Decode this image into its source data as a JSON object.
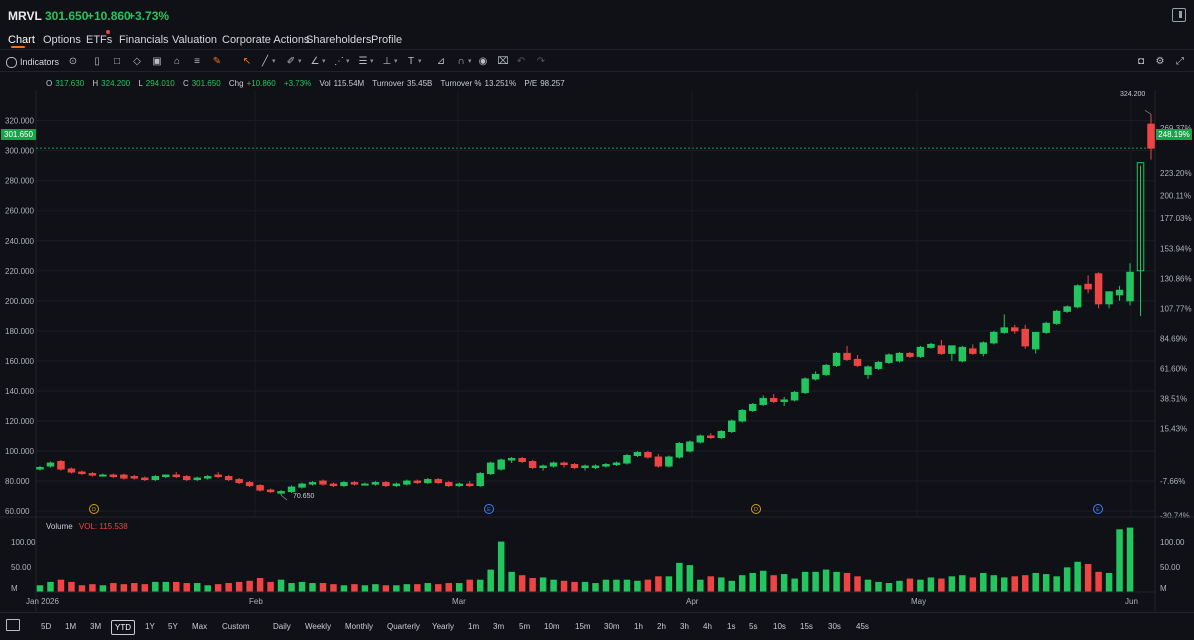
{
  "header": {
    "ticker": "MRVL",
    "price": "301.650",
    "change": "+10.860",
    "change_pct": "+3.73%"
  },
  "tabs": [
    {
      "label": "Chart",
      "active": true
    },
    {
      "label": "Options"
    },
    {
      "label": "ETFs"
    },
    {
      "label": "Financials"
    },
    {
      "label": "Valuation"
    },
    {
      "label": "Corporate Actions"
    },
    {
      "label": "Shareholders"
    },
    {
      "label": "Profile"
    }
  ],
  "toolbar": {
    "indicators_label": "Indicators"
  },
  "ohlc": {
    "o_label": "O",
    "o": "317.630",
    "h_label": "H",
    "h": "324.200",
    "l_label": "L",
    "l": "294.010",
    "c_label": "C",
    "c": "301.650",
    "chg_label": "Chg",
    "chg": "+10.860",
    "chg_pct": "+3.73%",
    "vol_label": "Vol",
    "vol": "115.54M",
    "turnover_label": "Turnover",
    "turnover": "35.45B",
    "turnover_pct_label": "Turnover %",
    "turnover_pct": "13.251%",
    "pe_label": "P/E",
    "pe": "98.257"
  },
  "price_tag": "301.650",
  "pct_tag": "248.19%",
  "high_label": "324.200",
  "low_label": "70.650",
  "volume": {
    "title": "Volume",
    "value": "VOL: 115.538",
    "axis": [
      "100.00",
      "50.00",
      "M"
    ]
  },
  "colors": {
    "up": "#22c55e",
    "down": "#ef4444",
    "accent": "#f97316"
  },
  "events": [
    {
      "label": "D",
      "color": "#d4a017"
    },
    {
      "label": "E",
      "color": "#3b82f6"
    },
    {
      "label": "D",
      "color": "#d4a017"
    },
    {
      "label": "E",
      "color": "#3b82f6"
    }
  ],
  "chart_data": {
    "type": "candlestick",
    "y_ticks": [
      "320.000",
      "300.000",
      "280.000",
      "260.000",
      "240.000",
      "220.000",
      "200.000",
      "180.000",
      "160.000",
      "140.000",
      "120.000",
      "100.000",
      "80.000",
      "60.000"
    ],
    "pct_ticks": [
      "269.37%",
      "223.20%",
      "200.11%",
      "177.03%",
      "153.94%",
      "130.86%",
      "107.77%",
      "84.69%",
      "61.60%",
      "38.51%",
      "15.43%",
      "-7.66%",
      "-30.74%"
    ],
    "x_labels": [
      "Jan 2026",
      "Feb",
      "Mar",
      "Apr",
      "May",
      "Jun"
    ],
    "ylim": [
      56,
      330
    ],
    "candles": [
      [
        88,
        90,
        87,
        89
      ],
      [
        90,
        93,
        89,
        92
      ],
      [
        93,
        94,
        87,
        88
      ],
      [
        88,
        89,
        85,
        86
      ],
      [
        86,
        87,
        84,
        85
      ],
      [
        85,
        86,
        83,
        84
      ],
      [
        84,
        85,
        83,
        84
      ],
      [
        84,
        85,
        82,
        83
      ],
      [
        84,
        85,
        81,
        82
      ],
      [
        83,
        84,
        81,
        82
      ],
      [
        82,
        83,
        80,
        81
      ],
      [
        81,
        84,
        80,
        83
      ],
      [
        83,
        84,
        82,
        84
      ],
      [
        84,
        86,
        82,
        83
      ],
      [
        83,
        84,
        80,
        81
      ],
      [
        81,
        83,
        80,
        82
      ],
      [
        82,
        84,
        81,
        83
      ],
      [
        84,
        86,
        82,
        83
      ],
      [
        83,
        84,
        80,
        81
      ],
      [
        81,
        82,
        78,
        79
      ],
      [
        79,
        80,
        76,
        77
      ],
      [
        77,
        78,
        73,
        74
      ],
      [
        74,
        75,
        72,
        73
      ],
      [
        72,
        74,
        70.65,
        73
      ],
      [
        73,
        77,
        72,
        76
      ],
      [
        76,
        79,
        75,
        78
      ],
      [
        78,
        80,
        77,
        79
      ],
      [
        80,
        81,
        77,
        78
      ],
      [
        78,
        79,
        76,
        77
      ],
      [
        77,
        80,
        76,
        79
      ],
      [
        79,
        80,
        77,
        78
      ],
      [
        78,
        79,
        77,
        78
      ],
      [
        78,
        80,
        77,
        79
      ],
      [
        79,
        80,
        76,
        77
      ],
      [
        77,
        79,
        76,
        78
      ],
      [
        78,
        81,
        77,
        80
      ],
      [
        80,
        81,
        78,
        79
      ],
      [
        79,
        82,
        78,
        81
      ],
      [
        81,
        82,
        78,
        79
      ],
      [
        79,
        80,
        76,
        77
      ],
      [
        77,
        79,
        76,
        78
      ],
      [
        78,
        80,
        76,
        77
      ],
      [
        77,
        86,
        76,
        85
      ],
      [
        85,
        93,
        84,
        92
      ],
      [
        88,
        95,
        87,
        94
      ],
      [
        94,
        96,
        92,
        95
      ],
      [
        95,
        96,
        92,
        93
      ],
      [
        93,
        94,
        88,
        89
      ],
      [
        89,
        91,
        87,
        90
      ],
      [
        90,
        93,
        89,
        92
      ],
      [
        92,
        93,
        89,
        91
      ],
      [
        91,
        92,
        88,
        89
      ],
      [
        89,
        91,
        87,
        90
      ],
      [
        89,
        91,
        88,
        90
      ],
      [
        90,
        92,
        89,
        91
      ],
      [
        91,
        93,
        90,
        92
      ],
      [
        92,
        98,
        91,
        97
      ],
      [
        97,
        100,
        96,
        99
      ],
      [
        99,
        100,
        95,
        96
      ],
      [
        96,
        98,
        89,
        90
      ],
      [
        90,
        97,
        89,
        96
      ],
      [
        96,
        106,
        95,
        105
      ],
      [
        100,
        107,
        99,
        106
      ],
      [
        106,
        111,
        105,
        110
      ],
      [
        110,
        112,
        108,
        109
      ],
      [
        109,
        114,
        108,
        113
      ],
      [
        113,
        121,
        112,
        120
      ],
      [
        120,
        128,
        119,
        127
      ],
      [
        127,
        132,
        126,
        131
      ],
      [
        131,
        137,
        130,
        135
      ],
      [
        135,
        138,
        132,
        133
      ],
      [
        133,
        136,
        130,
        134
      ],
      [
        134,
        140,
        133,
        139
      ],
      [
        139,
        149,
        138,
        148
      ],
      [
        148,
        153,
        147,
        151
      ],
      [
        151,
        158,
        150,
        157
      ],
      [
        157,
        166,
        156,
        165
      ],
      [
        165,
        170,
        160,
        161
      ],
      [
        161,
        164,
        156,
        157
      ],
      [
        151,
        157,
        148,
        156
      ],
      [
        155,
        160,
        154,
        159
      ],
      [
        159,
        165,
        158,
        164
      ],
      [
        160,
        166,
        159,
        165
      ],
      [
        165,
        166,
        162,
        163
      ],
      [
        163,
        170,
        162,
        169
      ],
      [
        169,
        172,
        168,
        171
      ],
      [
        170,
        174,
        164,
        165
      ],
      [
        165,
        168,
        160,
        170
      ],
      [
        160,
        170,
        159,
        169
      ],
      [
        168,
        171,
        164,
        165
      ],
      [
        165,
        173,
        163,
        172
      ],
      [
        172,
        180,
        171,
        179
      ],
      [
        179,
        191,
        178,
        182
      ],
      [
        182,
        184,
        178,
        180
      ],
      [
        181,
        184,
        168,
        170
      ],
      [
        168,
        176,
        165,
        179
      ],
      [
        179,
        186,
        178,
        185
      ],
      [
        185,
        194,
        184,
        193
      ],
      [
        193,
        197,
        192,
        196
      ],
      [
        196,
        211,
        195,
        210
      ],
      [
        211,
        217,
        205,
        208
      ],
      [
        218,
        219,
        195,
        198
      ],
      [
        198,
        205,
        195,
        206
      ],
      [
        204,
        210,
        200,
        207
      ],
      [
        200,
        225,
        197,
        219
      ],
      [
        220,
        290,
        190,
        292
      ],
      [
        317.63,
        324.2,
        294.01,
        301.65
      ]
    ],
    "volumes": [
      12,
      18,
      22,
      18,
      12,
      14,
      12,
      16,
      14,
      16,
      14,
      18,
      18,
      18,
      16,
      16,
      12,
      14,
      16,
      18,
      20,
      25,
      18,
      22,
      16,
      18,
      16,
      16,
      14,
      12,
      14,
      12,
      14,
      12,
      12,
      14,
      14,
      16,
      14,
      16,
      16,
      22,
      22,
      40,
      90,
      36,
      30,
      25,
      26,
      22,
      20,
      18,
      18,
      16,
      22,
      22,
      22,
      20,
      22,
      28,
      28,
      52,
      48,
      22,
      28,
      26,
      20,
      30,
      34,
      38,
      30,
      32,
      24,
      36,
      36,
      40,
      36,
      34,
      28,
      22,
      18,
      16,
      20,
      24,
      22,
      26,
      24,
      28,
      30,
      26,
      34,
      30,
      26,
      28,
      30,
      34,
      32,
      28,
      44,
      54,
      50,
      36,
      34,
      112,
      115
    ]
  }
}
